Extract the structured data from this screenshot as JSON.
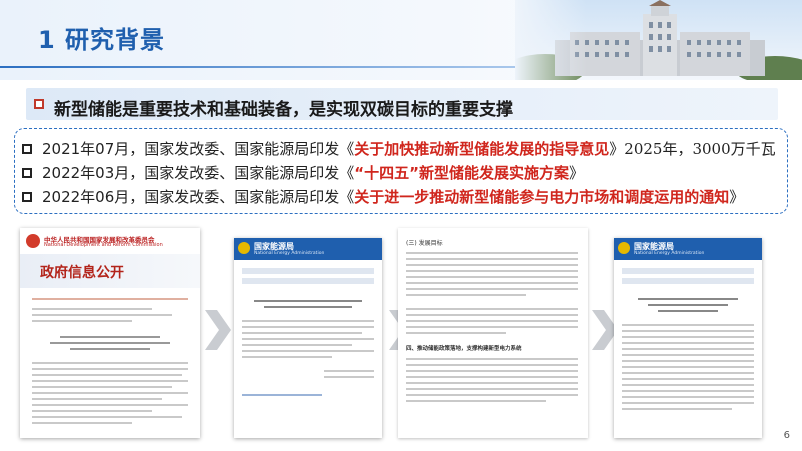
{
  "header": {
    "title": "1 研究背景"
  },
  "subtitle": {
    "text": "新型储能是重要技术和基础装备，是实现双碳目标的重要支撑"
  },
  "bullets": [
    {
      "prefix": "2021年07月，国家发改委、国家能源局印发《",
      "emph": "关于加快推动新型储能发展的指导意见",
      "suffix": "》",
      "tail": "2025年，3000万千瓦"
    },
    {
      "prefix": "2022年03月，国家发改委、国家能源局印发《",
      "emph": "“十四五”新型储能发展实施方案",
      "suffix": "》",
      "tail": ""
    },
    {
      "prefix": "2022年06月，国家发改委、国家能源局印发《",
      "emph": "关于进一步推动新型储能参与电力市场和调度运用的通知",
      "suffix": "》",
      "tail": ""
    }
  ],
  "docs": {
    "doc1": {
      "org_cn": "中华人民共和国国家发展和改革委员会",
      "org_en": "National Development and Reform Commission",
      "heading": "政府信息公开"
    },
    "doc2": {
      "org_cn": "国家能源局",
      "org_en": "National Energy Administration"
    },
    "doc3": {
      "section1": "(三) 发展目标",
      "section2": "四、推动储能政策落地，支撑构建新型电力系统"
    },
    "doc4": {
      "org_cn": "国家能源局",
      "org_en": "National Energy Administration"
    }
  },
  "page_number": "6",
  "colors": {
    "accent_blue": "#1f5fae",
    "emphasis_red": "#d0261d",
    "bullet_red": "#c0392b"
  }
}
